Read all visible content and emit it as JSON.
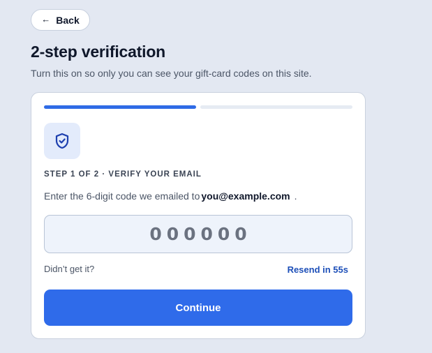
{
  "header": {
    "back_label": "Back",
    "back_icon": "arrow-left-icon",
    "title": "2-step verification",
    "subtitle": "Turn this on so only you can see your gift-card codes on this site."
  },
  "progress": {
    "current_step": 1,
    "total_steps": 2,
    "active_color": "#2f6be6",
    "inactive_color": "#e6ebf3"
  },
  "step": {
    "icon": "shield-check-icon",
    "label": "STEP 1 OF 2 · VERIFY YOUR EMAIL",
    "instruction_prefix": "Enter the 6-digit code we emailed to",
    "email": "you@example.com",
    "instruction_suffix": "."
  },
  "code_input": {
    "placeholder": "000000",
    "value": ""
  },
  "resend": {
    "prompt": "Didn’t get it?",
    "label": "Resend in 55s"
  },
  "actions": {
    "continue_label": "Continue",
    "accent_color": "#2f6bea"
  }
}
